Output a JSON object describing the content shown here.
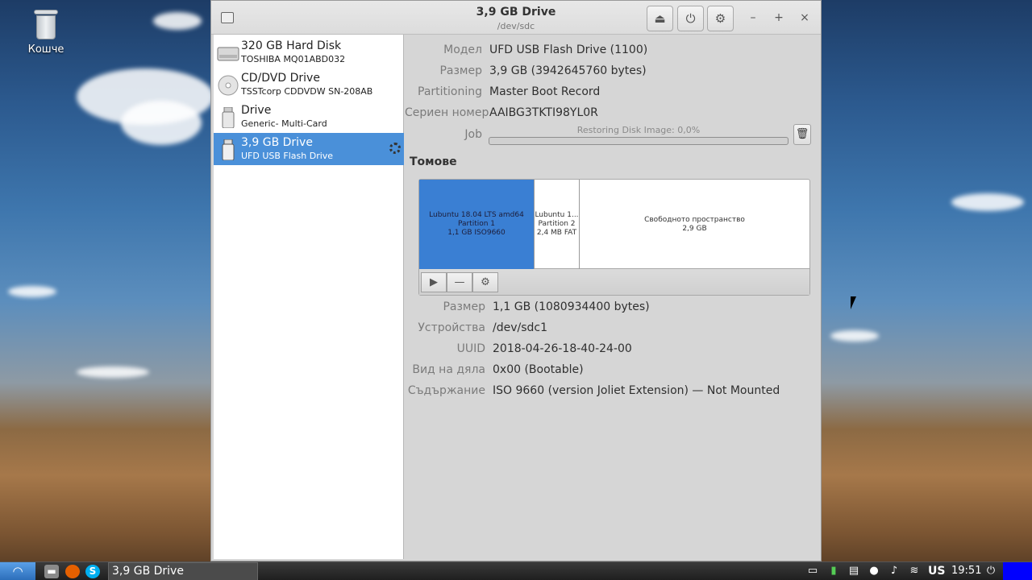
{
  "desktop": {
    "trash_label": "Кошче"
  },
  "window": {
    "title": "3,9 GB Drive",
    "subtitle": "/dev/sdc",
    "buttons": {
      "eject": "⏏",
      "power": "⏻",
      "settings": "⚙",
      "minimize": "–",
      "maximize": "+",
      "close": "×"
    }
  },
  "sidebar": {
    "drives": [
      {
        "name": "320 GB Hard Disk",
        "desc": "TOSHIBA MQ01ABD032",
        "icon": "hard-disk-icon"
      },
      {
        "name": "CD/DVD Drive",
        "desc": "TSSTcorp CDDVDW SN-208AB",
        "icon": "optical-disc-icon"
      },
      {
        "name": "Drive",
        "desc": "Generic- Multi-Card",
        "icon": "usb-drive-icon"
      },
      {
        "name": "3,9 GB Drive",
        "desc": "UFD USB Flash Drive",
        "icon": "usb-drive-icon",
        "selected": true
      }
    ]
  },
  "drive_props": {
    "model_label": "Модел",
    "model_value": "UFD USB Flash Drive (1100)",
    "size_label": "Размер",
    "size_value": "3,9 GB (3942645760 bytes)",
    "partitioning_label": "Partitioning",
    "partitioning_value": "Master Boot Record",
    "serial_label": "Сериен номер",
    "serial_value": "AAIBG3TKTI98YL0R",
    "job_label": "Job",
    "job_text": "Restoring Disk Image: 0,0%",
    "job_progress": 0.0
  },
  "volumes": {
    "title": "Томове",
    "partitions": [
      {
        "lines": [
          "Lubuntu 18.04 LTS amd64",
          "Partition 1",
          "1,1 GB ISO9660"
        ],
        "selected": true
      },
      {
        "lines": [
          "Lubuntu 1...",
          "Partition 2",
          "2,4 MB FAT"
        ],
        "selected": false
      },
      {
        "lines": [
          "Свободното пространство",
          "2,9 GB"
        ],
        "selected": false
      }
    ],
    "toolbar": {
      "play": "▶",
      "minus": "—",
      "gear": "⚙"
    }
  },
  "volume_props": {
    "size_label": "Размер",
    "size_value": "1,1 GB (1080934400 bytes)",
    "device_label": "Устройства",
    "device_value": "/dev/sdc1",
    "uuid_label": "UUID",
    "uuid_value": "2018-04-26-18-40-24-00",
    "type_label": "Вид на дяла",
    "type_value": "0x00 (Bootable)",
    "contents_label": "Съдържание",
    "contents_value": "ISO 9660 (version Joliet Extension) — Not Mounted"
  },
  "taskbar": {
    "task_label": "3,9 GB Drive",
    "keyboard": "US",
    "clock": "19:51"
  }
}
